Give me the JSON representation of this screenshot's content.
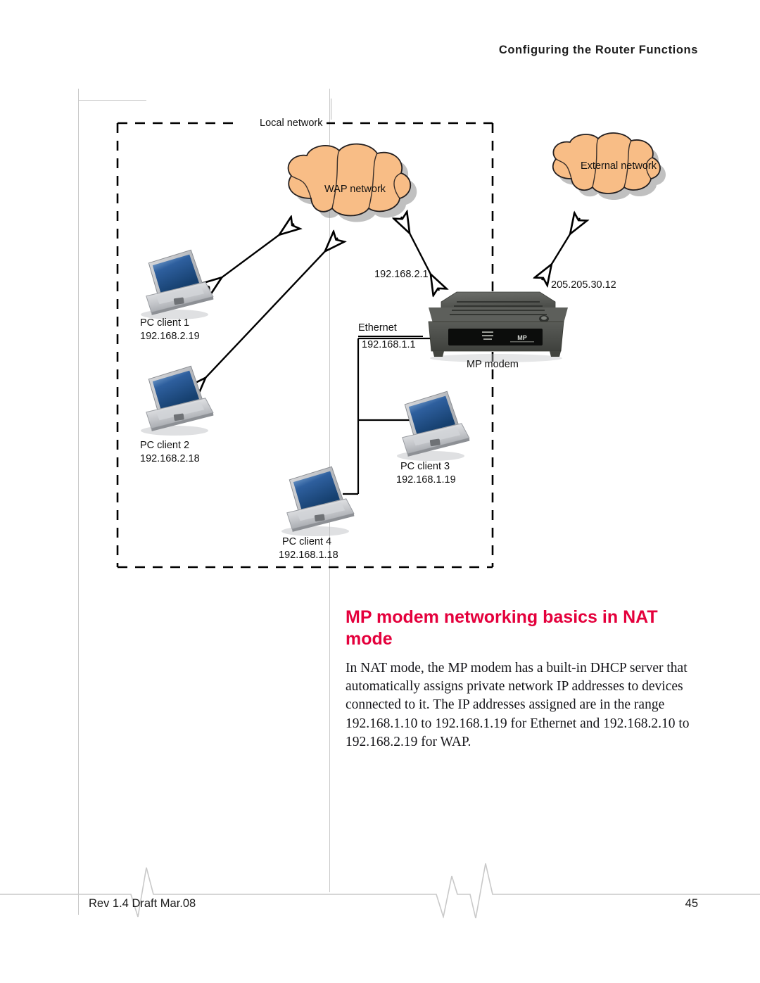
{
  "header": {
    "running_title": "Configuring the Router Functions"
  },
  "diagram": {
    "local_network_label": "Local network",
    "wap_cloud_label": "WAP network",
    "external_cloud_label": "External network",
    "modem_label": "MP modem",
    "modem_wap_ip": "192.168.2.1",
    "modem_external_ip": "205.205.30.12",
    "ethernet_label": "Ethernet",
    "ethernet_ip": "192.168.1.1",
    "clients": [
      {
        "name": "PC client 1",
        "ip": "192.168.2.19"
      },
      {
        "name": "PC client 2",
        "ip": "192.168.2.18"
      },
      {
        "name": "PC client 3",
        "ip": "192.168.1.19"
      },
      {
        "name": "PC client 4",
        "ip": "192.168.1.18"
      }
    ],
    "colors": {
      "cloud_fill": "#f8bd86",
      "cloud_stroke": "#231f20",
      "cloud_shadow": "#808080",
      "line": "#000000"
    }
  },
  "content": {
    "heading": "MP modem networking basics in NAT mode",
    "paragraph": "In NAT mode, the MP modem has a built-in DHCP server that automatically assigns private network IP addresses to devices connected to it. The IP addresses assigned are in the range 192.168.1.10 to 192.168.1.19 for Ethernet and 192.168.2.10 to 192.168.2.19 for WAP."
  },
  "footer": {
    "revision": "Rev 1.4 Draft  Mar.08",
    "page_number": "45"
  },
  "theme": {
    "heading_color": "#e4003c",
    "rule_color": "#c9c9c9"
  }
}
